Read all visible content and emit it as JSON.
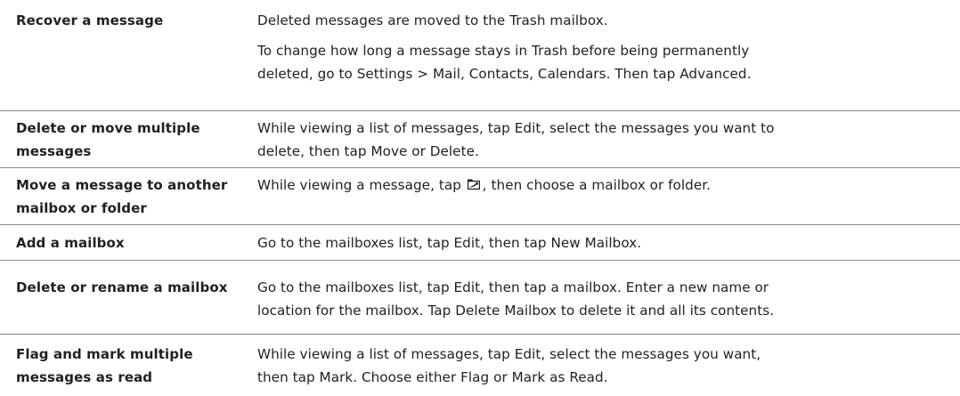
{
  "rows": [
    {
      "action_lines": [
        "Recover a message"
      ],
      "desc_paragraphs": [
        [
          "Deleted messages are moved to the Trash mailbox."
        ],
        [
          "To change how long a message stays in Trash before being permanently",
          "deleted, go to Settings > Mail, Contacts, Calendars. Then tap Advanced."
        ]
      ]
    },
    {
      "action_lines": [
        "Delete or move multiple",
        "messages"
      ],
      "desc_paragraphs": [
        [
          "While viewing a list of messages, tap Edit, select the messages you want to",
          "delete, then tap Move or Delete."
        ]
      ]
    },
    {
      "action_lines": [
        "Move a message to another",
        "mailbox or folder"
      ],
      "desc_before_icon": "While viewing a message, tap",
      "desc_icon": "move-to-folder-icon",
      "desc_after_icon": ", then choose a mailbox or folder."
    },
    {
      "action_lines": [
        "Add a mailbox"
      ],
      "desc_paragraphs": [
        [
          "Go to the mailboxes list, tap Edit, then tap New Mailbox."
        ]
      ]
    },
    {
      "action_lines": [
        "Delete or rename a mailbox"
      ],
      "desc_paragraphs": [
        [
          "Go to the mailboxes list, tap Edit, then tap a mailbox. Enter a new name or",
          "location for the mailbox. Tap Delete Mailbox to delete it and all its contents."
        ]
      ]
    },
    {
      "action_lines": [
        "Flag and mark multiple",
        "messages as read"
      ],
      "desc_paragraphs": [
        [
          "While viewing a list of messages, tap Edit, select the messages you want,",
          "then tap Mark. Choose either Flag or Mark as Read."
        ]
      ]
    }
  ]
}
